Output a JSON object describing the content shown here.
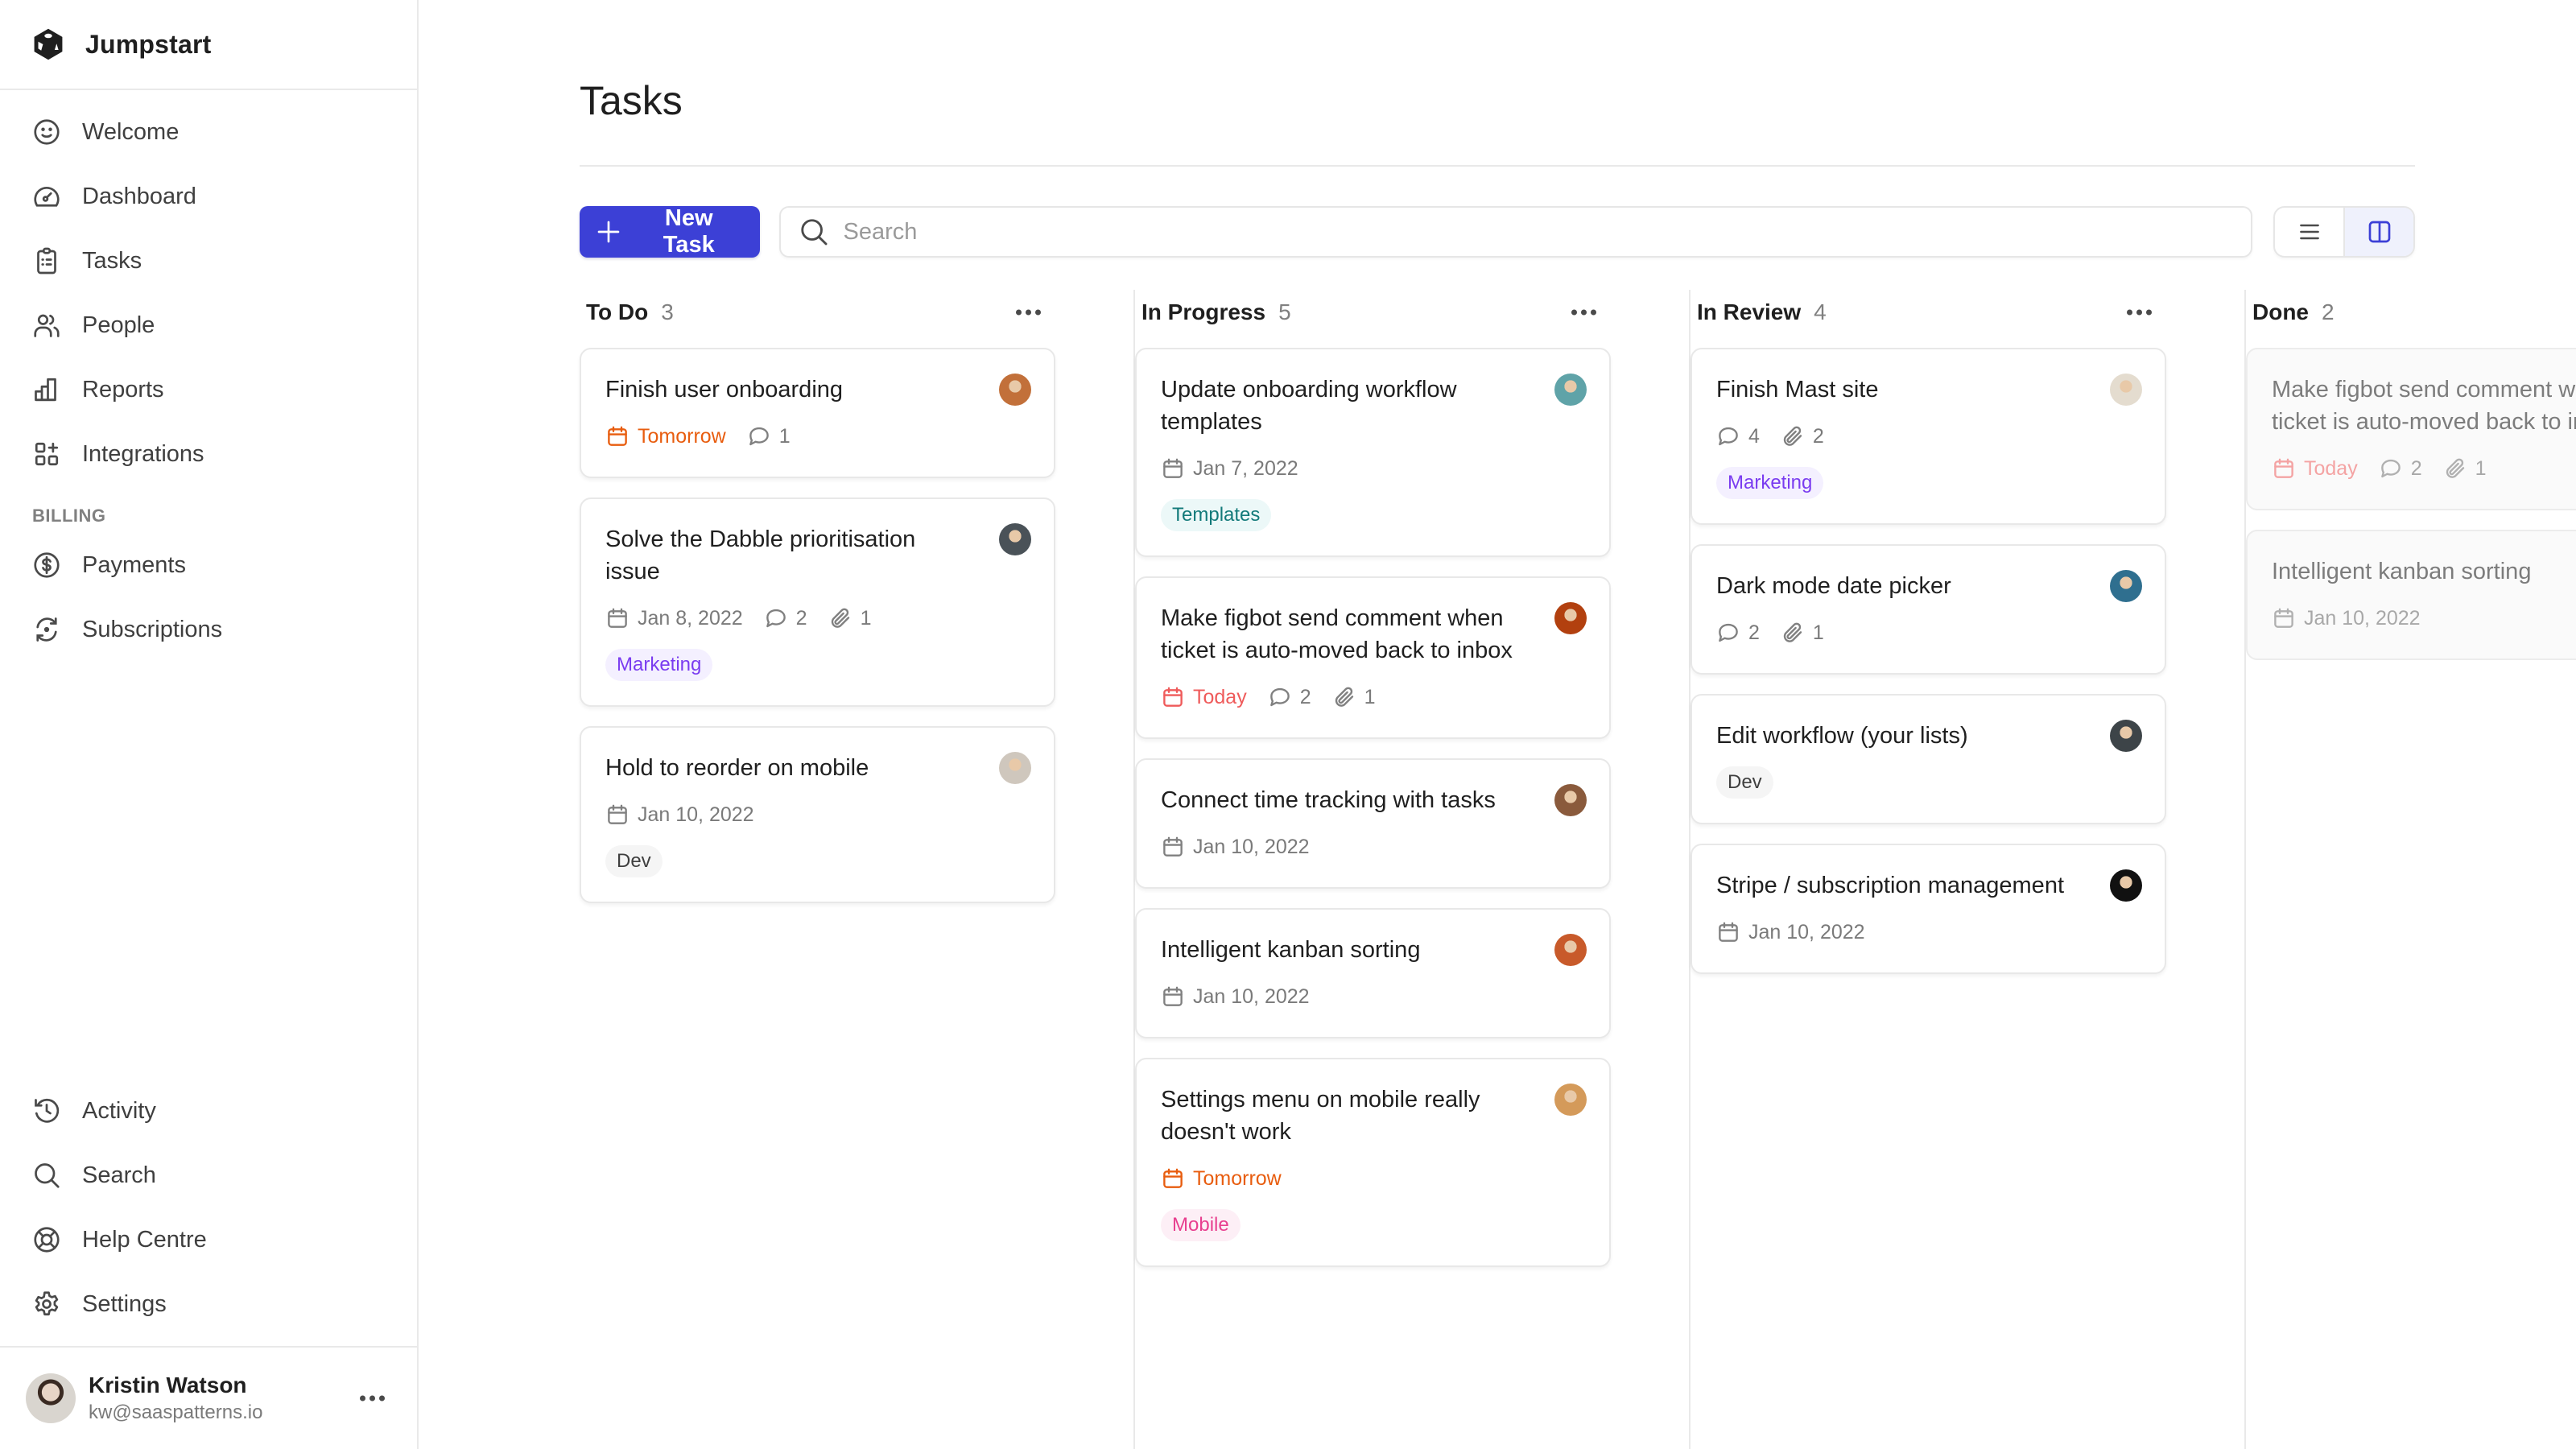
{
  "app": {
    "name": "Jumpstart"
  },
  "sidebar": {
    "main_items": [
      {
        "label": "Welcome",
        "icon": "smile-icon"
      },
      {
        "label": "Dashboard",
        "icon": "gauge-icon"
      },
      {
        "label": "Tasks",
        "icon": "clipboard-icon"
      },
      {
        "label": "People",
        "icon": "users-icon"
      },
      {
        "label": "Reports",
        "icon": "bar-chart-icon"
      },
      {
        "label": "Integrations",
        "icon": "apps-add-icon"
      }
    ],
    "billing_section": "BILLING",
    "billing_items": [
      {
        "label": "Payments",
        "icon": "dollar-circle-icon"
      },
      {
        "label": "Subscriptions",
        "icon": "refresh-icon"
      }
    ],
    "bottom_items": [
      {
        "label": "Activity",
        "icon": "history-icon"
      },
      {
        "label": "Search",
        "icon": "search-icon"
      },
      {
        "label": "Help Centre",
        "icon": "lifebuoy-icon"
      },
      {
        "label": "Settings",
        "icon": "gear-icon"
      }
    ],
    "user": {
      "name": "Kristin Watson",
      "email": "kw@saaspatterns.io"
    }
  },
  "header": {
    "title": "Tasks"
  },
  "toolbar": {
    "new_task_label": "New Task",
    "search_placeholder": "Search",
    "search_value": "",
    "view_modes": [
      "list",
      "board"
    ],
    "active_view": "board"
  },
  "colors": {
    "accent": "#3c40d6",
    "due_soon": "#e85d0f",
    "due_today": "#ef5b5b"
  },
  "columns": [
    {
      "title": "To Do",
      "count": "3",
      "cards": [
        {
          "title": "Finish user onboarding",
          "avatar": "#c2703a",
          "due": "Tomorrow",
          "due_status": "soon",
          "comments": "1",
          "attachments": null,
          "tag": null
        },
        {
          "title": "Solve the Dabble prioritisation issue",
          "avatar": "#4a5258",
          "due": "Jan 8, 2022",
          "due_status": "normal",
          "comments": "2",
          "attachments": "1",
          "tag": {
            "label": "Marketing",
            "kind": "marketing"
          }
        },
        {
          "title": "Hold to reorder on mobile",
          "avatar": "#cfc7bd",
          "due": "Jan 10, 2022",
          "due_status": "normal",
          "comments": null,
          "attachments": null,
          "tag": {
            "label": "Dev",
            "kind": "dev"
          }
        }
      ]
    },
    {
      "title": "In Progress",
      "count": "5",
      "cards": [
        {
          "title": "Update onboarding workflow templates",
          "avatar": "#5fa3a8",
          "due": "Jan 7, 2022",
          "due_status": "normal",
          "comments": null,
          "attachments": null,
          "tag": {
            "label": "Templates",
            "kind": "templates"
          }
        },
        {
          "title": "Make figbot send comment when ticket is auto-moved back to inbox",
          "avatar": "#b2400f",
          "due": "Today",
          "due_status": "today",
          "comments": "2",
          "attachments": "1",
          "tag": null
        },
        {
          "title": "Connect time tracking with tasks",
          "avatar": "#8a5a3c",
          "due": "Jan 10, 2022",
          "due_status": "normal",
          "comments": null,
          "attachments": null,
          "tag": null
        },
        {
          "title": "Intelligent kanban sorting",
          "avatar": "#c85a2a",
          "due": "Jan 10, 2022",
          "due_status": "normal",
          "comments": null,
          "attachments": null,
          "tag": null
        },
        {
          "title": "Settings menu on mobile really doesn't work",
          "avatar": "#d49a5a",
          "due": "Tomorrow",
          "due_status": "soon",
          "comments": null,
          "attachments": null,
          "tag": {
            "label": "Mobile",
            "kind": "mobile"
          }
        }
      ]
    },
    {
      "title": "In Review",
      "count": "4",
      "cards": [
        {
          "title": "Finish Mast site",
          "avatar": "#e4dccf",
          "due": null,
          "due_status": null,
          "comments": "4",
          "attachments": "2",
          "tag": {
            "label": "Marketing",
            "kind": "marketing"
          }
        },
        {
          "title": "Dark mode date picker",
          "avatar": "#2f6f8f",
          "due": null,
          "due_status": null,
          "comments": "2",
          "attachments": "1",
          "tag": null
        },
        {
          "title": "Edit workflow (your lists)",
          "avatar": "#3d4448",
          "due": null,
          "due_status": null,
          "comments": null,
          "attachments": null,
          "tag": {
            "label": "Dev",
            "kind": "dev"
          }
        },
        {
          "title": "Stripe / subscription management",
          "avatar": "#111111",
          "due": "Jan 10, 2022",
          "due_status": "normal",
          "comments": null,
          "attachments": null,
          "tag": null
        }
      ]
    },
    {
      "title": "Done",
      "count": "2",
      "cards": [
        {
          "title": "Make figbot send comment when ticket is auto-moved back to inbox",
          "avatar": null,
          "due": "Today",
          "due_status": "today",
          "comments": "2",
          "attachments": "1",
          "tag": null
        },
        {
          "title": "Intelligent kanban sorting",
          "avatar": null,
          "due": "Jan 10, 2022",
          "due_status": "normal",
          "comments": null,
          "attachments": null,
          "tag": null
        }
      ]
    }
  ]
}
